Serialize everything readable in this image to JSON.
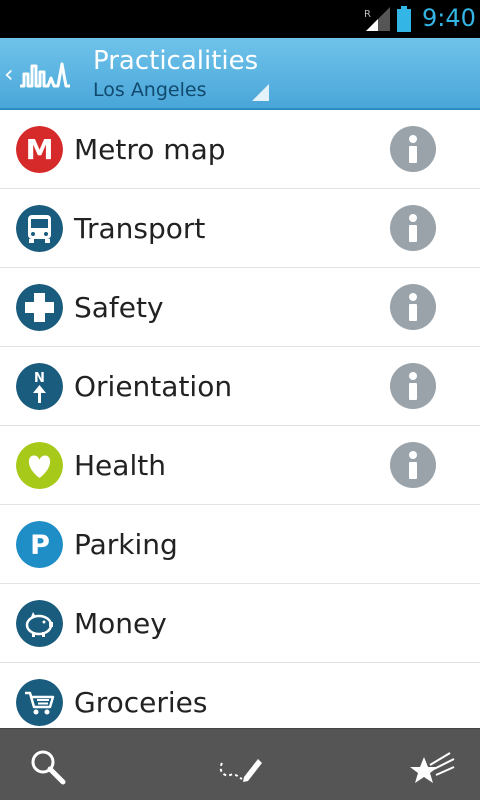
{
  "status_bar": {
    "time": "9:40",
    "roaming_indicator": "R",
    "accent_color": "#33b5e5"
  },
  "action_bar": {
    "title": "Practicalities",
    "subtitle": "Los Angeles",
    "up_icon": "chevron-left-icon",
    "logo_icon": "city-skyline-logo-icon"
  },
  "list": {
    "items": [
      {
        "label": "Metro map",
        "icon": "metro-icon",
        "icon_color": "#d62a2a",
        "has_info": true
      },
      {
        "label": "Transport",
        "icon": "bus-icon",
        "icon_color": "#1a5c7e",
        "has_info": true
      },
      {
        "label": "Safety",
        "icon": "cross-icon",
        "icon_color": "#1a5c7e",
        "has_info": true
      },
      {
        "label": "Orientation",
        "icon": "north-arrow-icon",
        "icon_color": "#1a5c7e",
        "has_info": true
      },
      {
        "label": "Health",
        "icon": "heart-icon",
        "icon_color": "#a6c91a",
        "has_info": true
      },
      {
        "label": "Parking",
        "icon": "parking-icon",
        "icon_color": "#1f8ec7",
        "has_info": false
      },
      {
        "label": "Money",
        "icon": "piggy-bank-icon",
        "icon_color": "#1a5c7e",
        "has_info": false
      },
      {
        "label": "Groceries",
        "icon": "shopping-cart-icon",
        "icon_color": "#1a5c7e",
        "has_info": false
      }
    ],
    "metro_letter": "M",
    "parking_letter": "P",
    "north_letter": "N",
    "info_icon": "info-icon"
  },
  "bottom_bar": {
    "tabs": [
      {
        "icon": "search-icon"
      },
      {
        "icon": "pencil-route-icon"
      },
      {
        "icon": "star-favorites-icon"
      }
    ]
  }
}
